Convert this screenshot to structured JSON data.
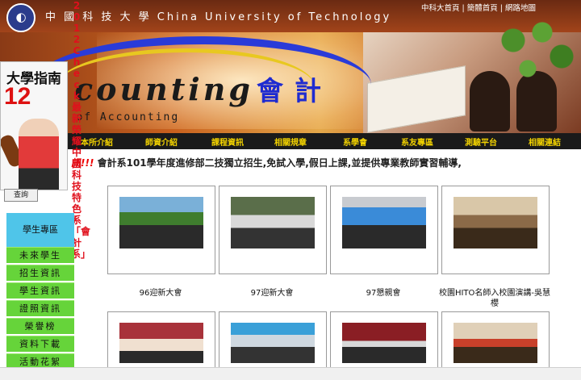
{
  "header": {
    "logo_glyph": "◐",
    "school_name": "中 國 科 技 大 學  China University of Technology",
    "top_links": "中科大首頁 | 簡體首頁 | 網路地圖",
    "banner_title": "counting",
    "banner_title_cn": "會計",
    "department": "partment of Accounting"
  },
  "nav": {
    "items": [
      "本所介紹",
      "師資介紹",
      "課程資訊",
      "相關規章",
      "系學會",
      "系友專區",
      "測驗平台",
      "相關連結"
    ]
  },
  "vertical_notice": "2012 Check 最新榮耀中國科技特色系「會計系」",
  "magazine": {
    "title": "大學指南",
    "number": "12"
  },
  "marquee": {
    "prefix": "訊!!!",
    "text": "會計系101學年度進修部二技獨立招生,免試入學,假日上課,並提供專業教師實習輔導,"
  },
  "sidebar": {
    "query_button": "查詢",
    "student_zone": "學生專區",
    "items": [
      "未來學生",
      "招生資訊",
      "學生資訊",
      "證照資訊",
      "榮譽榜",
      "資料下載",
      "活動花絮"
    ]
  },
  "gallery": {
    "row1": [
      {
        "caption": "96迎新大會"
      },
      {
        "caption": "97迎新大會"
      },
      {
        "caption": "97懇親會"
      },
      {
        "caption": "校園HITO名師入校園演講-吳慧櫻"
      }
    ]
  },
  "colors": {
    "nav_bg": "#1a1a1a",
    "nav_text": "#f2d200",
    "menu_green": "#66d43a",
    "student_zone_blue": "#4fc5e9",
    "notice_red": "#e0101c",
    "accent_blue": "#1f2bd0"
  }
}
